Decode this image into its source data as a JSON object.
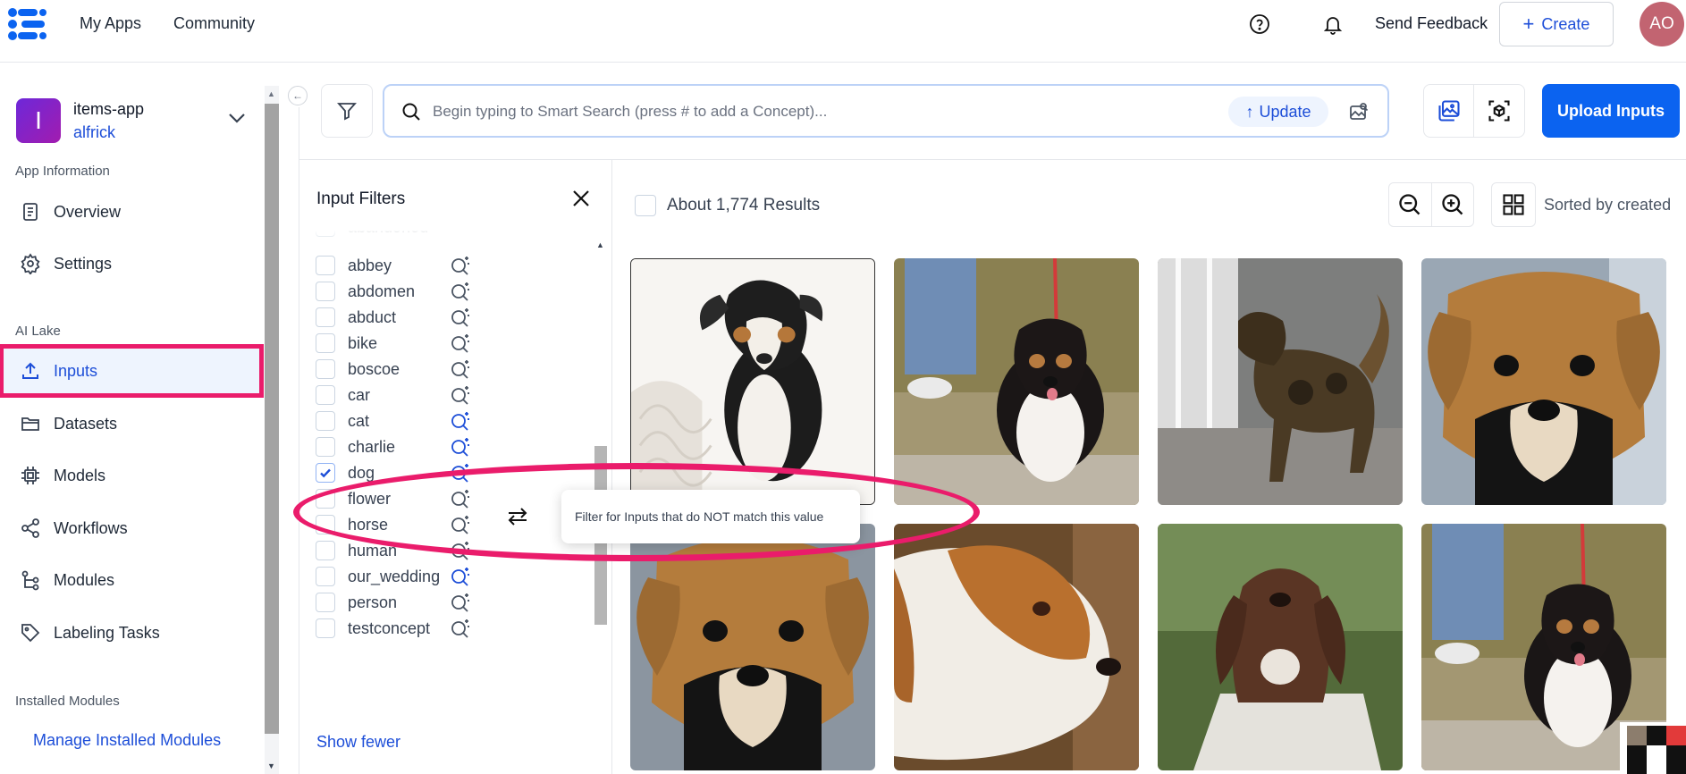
{
  "topnav": {
    "links": [
      "My Apps",
      "Community"
    ],
    "send_feedback": "Send Feedback",
    "create_label": "Create",
    "avatar_initials": "AO"
  },
  "sidebar": {
    "app_initial": "I",
    "app_name": "items-app",
    "app_owner": "alfrick",
    "section_app_info": "App Information",
    "overview": "Overview",
    "settings": "Settings",
    "section_ai_lake": "AI Lake",
    "inputs": "Inputs",
    "datasets": "Datasets",
    "models": "Models",
    "workflows": "Workflows",
    "modules": "Modules",
    "labeling_tasks": "Labeling Tasks",
    "section_installed": "Installed Modules",
    "manage_installed": "Manage Installed Modules"
  },
  "search": {
    "placeholder": "Begin typing to Smart Search (press # to add a Concept)...",
    "update_label": "Update",
    "upload_label": "Upload Inputs"
  },
  "filters": {
    "title": "Input Filters",
    "partial_top": "abandoned",
    "concepts": [
      {
        "label": "abbey",
        "checked": false,
        "active": false
      },
      {
        "label": "abdomen",
        "checked": false,
        "active": false
      },
      {
        "label": "abduct",
        "checked": false,
        "active": false
      },
      {
        "label": "bike",
        "checked": false,
        "active": false
      },
      {
        "label": "boscoe",
        "checked": false,
        "active": false
      },
      {
        "label": "car",
        "checked": false,
        "active": false
      },
      {
        "label": "cat",
        "checked": false,
        "active": true
      },
      {
        "label": "charlie",
        "checked": false,
        "active": true
      },
      {
        "label": "dog",
        "checked": true,
        "active": true
      },
      {
        "label": "flower",
        "checked": false,
        "active": false
      },
      {
        "label": "horse",
        "checked": false,
        "active": false
      },
      {
        "label": "human",
        "checked": false,
        "active": false
      },
      {
        "label": "our_wedding",
        "checked": false,
        "active": true
      },
      {
        "label": "person",
        "checked": false,
        "active": false
      },
      {
        "label": "testconcept",
        "checked": false,
        "active": false
      }
    ],
    "show_fewer": "Show fewer",
    "tooltip": "Filter for Inputs that do NOT match this value"
  },
  "results": {
    "count_text": "About 1,774 Results",
    "sorted_text": "Sorted by created"
  },
  "colors": {
    "accent": "#0b63f0",
    "highlight": "#ea1c6b",
    "link": "#1d4ed8"
  }
}
